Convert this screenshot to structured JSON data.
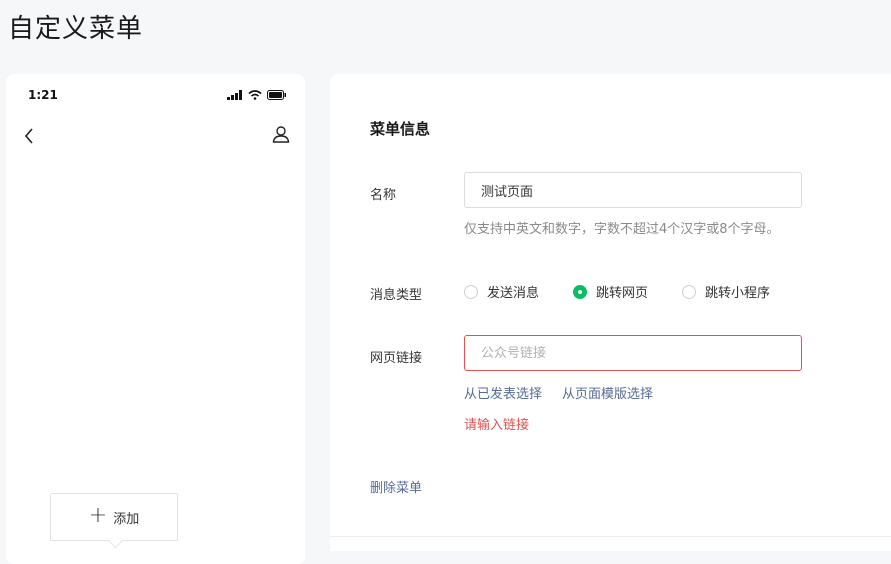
{
  "page": {
    "title": "自定义菜单"
  },
  "phone": {
    "time": "1:21",
    "icons": {
      "back": "chevron-left-icon",
      "user": "user-icon",
      "signal": "signal-icon",
      "wifi": "wifi-icon",
      "battery": "battery-icon"
    },
    "add_button_label": "添加"
  },
  "form": {
    "section_title": "菜单信息",
    "name": {
      "label": "名称",
      "value": "测试页面",
      "hint": "仅支持中英文和数字，字数不超过4个汉字或8个字母。"
    },
    "message_type": {
      "label": "消息类型",
      "options": [
        {
          "label": "发送消息",
          "checked": false
        },
        {
          "label": "跳转网页",
          "checked": true
        },
        {
          "label": "跳转小程序",
          "checked": false
        }
      ]
    },
    "url": {
      "label": "网页链接",
      "value": "",
      "placeholder": "公众号链接",
      "link_published": "从已发表选择",
      "link_template": "从页面模版选择",
      "error": "请输入链接"
    },
    "delete_label": "删除菜单"
  },
  "colors": {
    "accent_green": "#07c160",
    "error_red": "#e05252",
    "link_blue": "#576b95"
  }
}
